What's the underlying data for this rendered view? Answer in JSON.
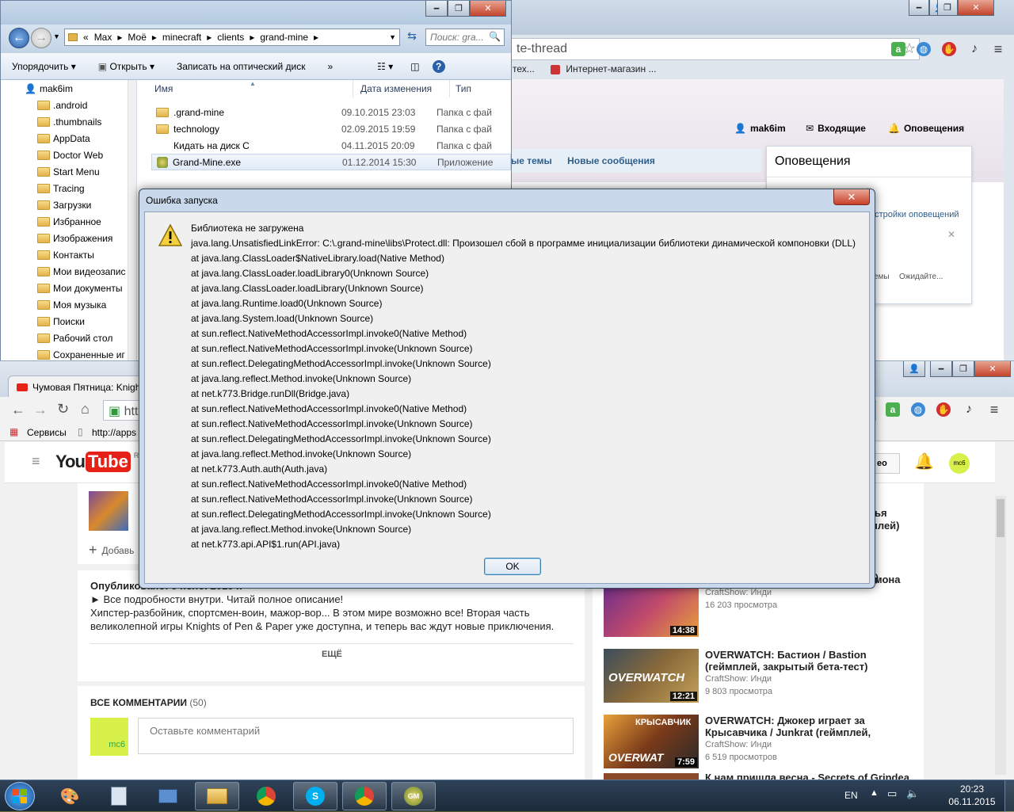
{
  "explorer": {
    "breadcrumb": [
      "«",
      "Max",
      "Моё",
      "minecraft",
      "clients",
      "grand-mine"
    ],
    "search_placeholder": "Поиск: gra...",
    "toolbar": {
      "organize": "Упорядочить",
      "open": "Открыть",
      "burn": "Записать на оптический диск",
      "more": "»"
    },
    "tree_root": "mak6im",
    "tree_items": [
      ".android",
      ".thumbnails",
      "AppData",
      "Doctor Web",
      "Start Menu",
      "Tracing",
      "Загрузки",
      "Избранное",
      "Изображения",
      "Контакты",
      "Мои видеозапис",
      "Мои документы",
      "Моя музыка",
      "Поиски",
      "Рабочий стол",
      "Сохраненные иг"
    ],
    "columns": {
      "name": "Имя",
      "date": "Дата изменения",
      "type": "Тип"
    },
    "files": [
      {
        "name": ".grand-mine",
        "date": "09.10.2015 23:03",
        "type": "Папка с фай",
        "icon": "folder"
      },
      {
        "name": "technology",
        "date": "02.09.2015 19:59",
        "type": "Папка с фай",
        "icon": "folder"
      },
      {
        "name": "Кидать на диск C",
        "date": "04.11.2015 20:09",
        "type": "Папка с фай",
        "icon": "none"
      },
      {
        "name": "Grand-Mine.exe",
        "date": "01.12.2014 15:30",
        "type": "Приложение",
        "icon": "exe"
      }
    ]
  },
  "chrome_top": {
    "address_fragment": "te-thread",
    "bookmark1": "тех...",
    "bookmark2": "Интернет-магазин ...",
    "user": "mak6im",
    "inbox": "Входящие",
    "alerts": "Оповещения",
    "nav_new_topics": "ые темы",
    "nav_new_messages": "Новые сообщения",
    "popup_title": "Оповещения",
    "popup_text": "й.",
    "popup_settings": "астройки оповещений",
    "frag_topics": "емы",
    "frag_waiting": "Ожидайте..."
  },
  "youtube": {
    "tab_title": "Чумовая Пятница: Knigh",
    "address_fragment": "htt",
    "bm_services": "Сервисы",
    "bm_apps": "http://apps",
    "logo_you": "You",
    "logo_tube": "Tube",
    "logo_region": "RU",
    "header_btn": "ео",
    "add_label": "Добавь",
    "published": "Опубликовано: 5 нояб. 2015 г.",
    "desc_line1": "► Все подробности внутри. Читай полное описание!",
    "desc_line2": "Хипстер-разбойник, спортсмен-воин, мажор-вор... В этом мире возможно все! Вторая часть",
    "desc_line3": "великолепной игры Knights of Pen & Paper уже доступна, и теперь вас ждут новые приключения.",
    "more": "ЕЩЁ",
    "comments_title": "ВСЕ КОММЕНТАРИИ",
    "comments_count": "(50)",
    "comment_placeholder": "Оставьте комментарий",
    "avatar_text": "mc6",
    "side_fragment1": "ья",
    "side_fragment2": "плей)",
    "side_fragment3": "мона",
    "videos": [
      {
        "title": "Пенсия в Dungeonland (геймплей)",
        "channel": "CraftShow: Инди",
        "views": "16 203 просмотра",
        "duration": "14:38"
      },
      {
        "title": "OVERWATCH: Бастион / Bastion (геймплей, закрытый бета-тест)",
        "channel": "CraftShow: Инди",
        "views": "9 803 просмотра",
        "duration": "12:21"
      },
      {
        "title": "OVERWATCH: Джокер играет за Крысавчика / Junkrat (геймплей,",
        "channel": "CraftShow: Инди",
        "views": "6 519 просмотров",
        "duration": "7:59"
      },
      {
        "title": "К нам пришла весна - Secrets of Grindea",
        "channel": "",
        "views": "",
        "duration": ""
      }
    ],
    "thumb_text_overwatch": "OVERWATCH",
    "thumb_text_krysavchik": "КРЫСАВЧИК",
    "thumb_text_overwat": "OVERWAT"
  },
  "dialog": {
    "title": "Ошибка запуска",
    "message_lines": [
      "Библиотека не загружена",
      "java.lang.UnsatisfiedLinkError: C:\\.grand-mine\\libs\\Protect.dll: Произошел сбой в программе инициализации библиотеки динамической компоновки (DLL)",
      "at java.lang.ClassLoader$NativeLibrary.load(Native Method)",
      "at java.lang.ClassLoader.loadLibrary0(Unknown Source)",
      "at java.lang.ClassLoader.loadLibrary(Unknown Source)",
      "at java.lang.Runtime.load0(Unknown Source)",
      "at java.lang.System.load(Unknown Source)",
      "at sun.reflect.NativeMethodAccessorImpl.invoke0(Native Method)",
      "at sun.reflect.NativeMethodAccessorImpl.invoke(Unknown Source)",
      "at sun.reflect.DelegatingMethodAccessorImpl.invoke(Unknown Source)",
      "at java.lang.reflect.Method.invoke(Unknown Source)",
      "at net.k773.Bridge.runDll(Bridge.java)",
      "at sun.reflect.NativeMethodAccessorImpl.invoke0(Native Method)",
      "at sun.reflect.NativeMethodAccessorImpl.invoke(Unknown Source)",
      "at sun.reflect.DelegatingMethodAccessorImpl.invoke(Unknown Source)",
      "at java.lang.reflect.Method.invoke(Unknown Source)",
      "at net.k773.Auth.auth(Auth.java)",
      "at sun.reflect.NativeMethodAccessorImpl.invoke0(Native Method)",
      "at sun.reflect.NativeMethodAccessorImpl.invoke(Unknown Source)",
      "at sun.reflect.DelegatingMethodAccessorImpl.invoke(Unknown Source)",
      "at java.lang.reflect.Method.invoke(Unknown Source)",
      "at net.k773.api.API$1.run(API.java)"
    ],
    "ok": "OK",
    "close_glyph": "✕"
  },
  "taskbar": {
    "lang": "EN",
    "time": "20:23",
    "date": "06.11.2015"
  },
  "colors": {
    "youtube_red": "#e62117",
    "accent_blue": "#2a5fa8",
    "dialog_frame": "#c9d8ea"
  }
}
